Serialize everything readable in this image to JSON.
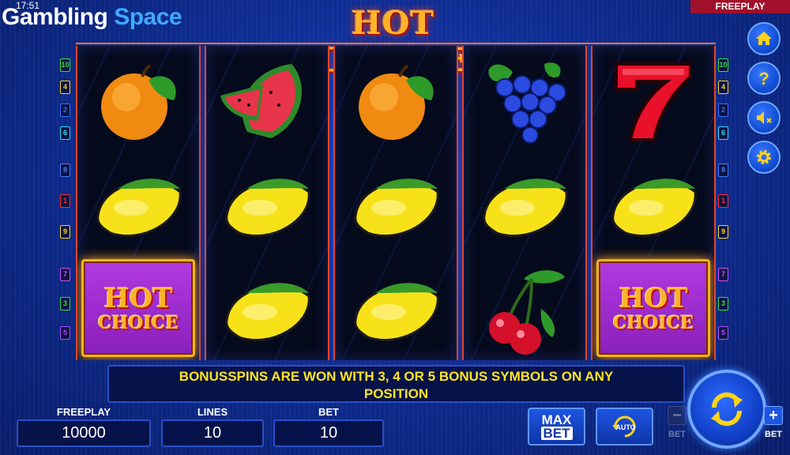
{
  "status": {
    "time": "17:51",
    "mode_badge": "FREEPLAY"
  },
  "brand": {
    "part1": "Gambling",
    "part2": "Space"
  },
  "game": {
    "title": "HOT CHOICE"
  },
  "reels": [
    [
      "orange",
      "lemon",
      "hot-choice"
    ],
    [
      "watermelon",
      "lemon",
      "lemon"
    ],
    [
      "orange",
      "lemon",
      "lemon"
    ],
    [
      "grapes",
      "lemon",
      "cherries"
    ],
    [
      "seven",
      "lemon",
      "hot-choice"
    ]
  ],
  "hot_choice_symbol": {
    "line1": "HOT",
    "line2": "CHOICE"
  },
  "line_indicators": {
    "left": [
      {
        "n": "10",
        "color": "#3adf3a"
      },
      {
        "n": "4",
        "color": "#ffd21a"
      },
      {
        "n": "2",
        "color": "#3a6dff"
      },
      {
        "n": "6",
        "color": "#2ae0ff"
      },
      {
        "n": "8",
        "color": "#4a7aff"
      },
      {
        "n": "1",
        "color": "#ff2a2a"
      },
      {
        "n": "9",
        "color": "#ffd21a"
      },
      {
        "n": "7",
        "color": "#d24aff"
      },
      {
        "n": "3",
        "color": "#3adf3a"
      },
      {
        "n": "5",
        "color": "#b04aff"
      }
    ],
    "right": [
      {
        "n": "10",
        "color": "#3adf3a"
      },
      {
        "n": "4",
        "color": "#ffd21a"
      },
      {
        "n": "2",
        "color": "#3a6dff"
      },
      {
        "n": "6",
        "color": "#2ae0ff"
      },
      {
        "n": "8",
        "color": "#4a7aff"
      },
      {
        "n": "1",
        "color": "#ff2a2a"
      },
      {
        "n": "9",
        "color": "#ffd21a"
      },
      {
        "n": "7",
        "color": "#d24aff"
      },
      {
        "n": "3",
        "color": "#3adf3a"
      },
      {
        "n": "5",
        "color": "#b04aff"
      }
    ]
  },
  "side_buttons": [
    "home-icon",
    "help-icon",
    "sound-muted-icon",
    "settings-icon"
  ],
  "message": {
    "line1": "BONUSSPINS ARE WON WITH 3, 4 OR 5 BONUS SYMBOLS ON ANY",
    "line2": "POSITION"
  },
  "stats": {
    "freeplay": {
      "label": "FREEPLAY",
      "value": "10000"
    },
    "lines": {
      "label": "LINES",
      "value": "10"
    },
    "bet": {
      "label": "BET",
      "value": "10"
    }
  },
  "controls": {
    "max_bet": {
      "line1": "MAX",
      "line2": "BET"
    },
    "auto": "AUTO",
    "bet_minus": {
      "sign": "−",
      "label": "BET"
    },
    "bet_plus": {
      "sign": "+",
      "label": "BET"
    }
  },
  "colors": {
    "accent": "#ffe51c",
    "reel_border": "#e0462a",
    "bg": "#0d2a8c"
  }
}
